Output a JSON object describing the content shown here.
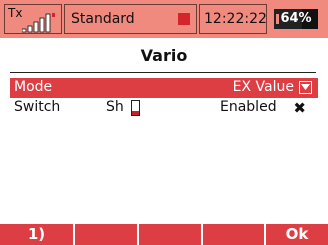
{
  "status_bar": {
    "tx_label": "Tx",
    "signal_icon": "signal-strength-icon",
    "model_name": "Standard",
    "recording_indicator_color": "#d5252c",
    "time": "12:22:22",
    "battery_percent_label": "64%",
    "battery_level": 64
  },
  "screen": {
    "title": "Vario"
  },
  "rows": {
    "mode": {
      "label": "Mode",
      "value": "EX Value",
      "icon": "dropdown-arrow-icon"
    },
    "switch": {
      "label": "Switch",
      "switch_name": "Sh",
      "switch_level": 30,
      "status": "Enabled",
      "icon": "close-x-icon"
    }
  },
  "footer": {
    "keys": [
      "1)",
      "",
      "",
      "",
      "Ok"
    ]
  },
  "colors": {
    "status_bar_bg": "#f08a7f",
    "accent_red": "#dd3e43",
    "text": "#111111"
  }
}
